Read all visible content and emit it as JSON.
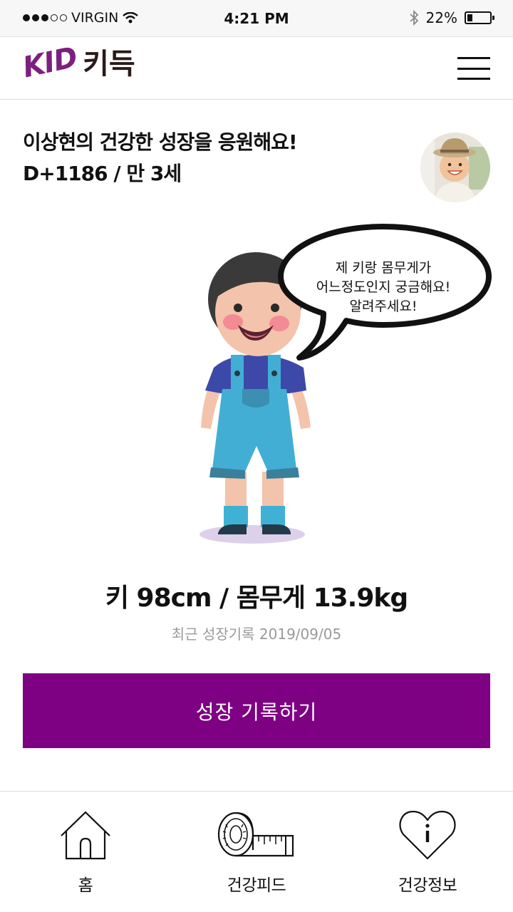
{
  "status_bar": {
    "carrier": "VIRGIN",
    "time": "4:21 PM",
    "battery_text": "22%",
    "battery_level": 0.22,
    "signal_bars_filled": 3,
    "signal_bars_total": 5
  },
  "header": {
    "logo_en": "KID",
    "logo_ko": "키득",
    "menu_icon": "hamburger-menu-icon"
  },
  "profile": {
    "greeting": "이상현의 건강한 성장을 응원해요!",
    "age_info": "D+1186 / 만 3세"
  },
  "speech_bubble": {
    "line1": "제 키랑 몸무게가",
    "line2": "어느정도인지 궁금해요!",
    "line3": "알려주세요!"
  },
  "stats": {
    "text": "키 98cm / 몸무게 13.9kg",
    "recent": "최근 성장기록 2019/09/05"
  },
  "actions": {
    "record_label": "성장 기록하기"
  },
  "tabs": [
    {
      "label": "홈",
      "icon": "house-icon"
    },
    {
      "label": "건강피드",
      "icon": "tape-measure-icon"
    },
    {
      "label": "건강정보",
      "icon": "heart-info-icon"
    }
  ],
  "colors": {
    "brand_purple": "#7e0083",
    "logo_purple": "#7d1f7e"
  }
}
